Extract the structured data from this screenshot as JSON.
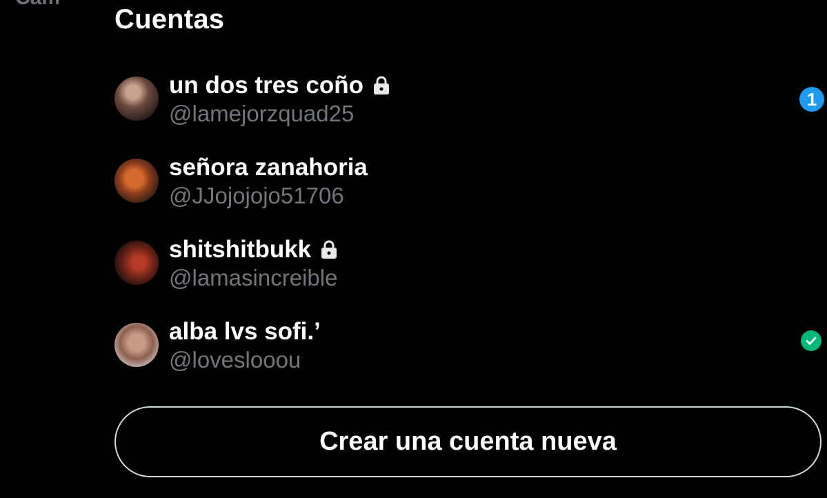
{
  "header": {
    "partial_text": "Cam",
    "title": "Cuentas"
  },
  "accounts": [
    {
      "name": "un dos tres coño",
      "handle": "@lamejorzquad25",
      "protected": true,
      "notification_count": "1"
    },
    {
      "name": "señora zanahoria",
      "handle": "@JJojojojo51706",
      "protected": false
    },
    {
      "name": "shitshitbukk",
      "handle": "@lamasincreible",
      "protected": true
    },
    {
      "name": "alba lvs sofi.ʼ",
      "handle": "@loveslooou",
      "protected": false,
      "active": true
    }
  ],
  "actions": {
    "create_account_label": "Crear una cuenta nueva"
  },
  "colors": {
    "background": "#000000",
    "secondary_text": "#71767b",
    "badge_blue": "#1d9bf0",
    "check_green": "#00ba7c"
  },
  "icons": {
    "lock": "lock-icon",
    "check": "check-icon",
    "count_badge": "notification-count-badge"
  }
}
